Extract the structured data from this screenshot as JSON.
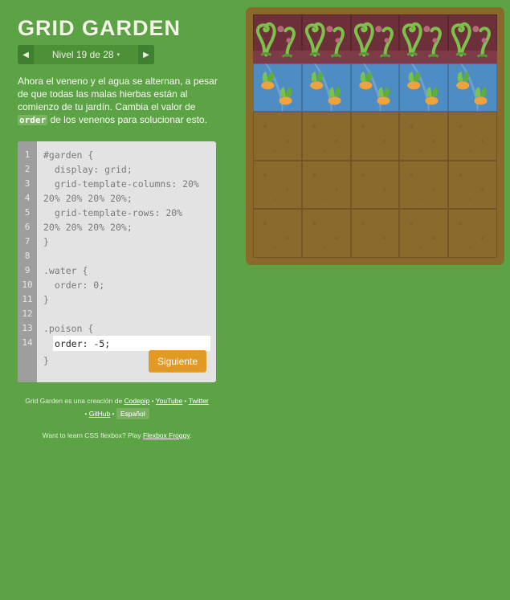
{
  "app": {
    "title": "GRID GARDEN"
  },
  "level_nav": {
    "prev_icon": "chevron-left-icon",
    "next_icon": "chevron-right-icon",
    "label": "Nivel 19 de 28",
    "caret": "▾"
  },
  "instructions": {
    "before_code": "Ahora el veneno y el agua se alternan, a pesar de que todas las malas hierbas están al comienzo de tu jardín. Cambia el valor de ",
    "code_word": "order",
    "after_code": " de los venenos para solucionar esto."
  },
  "editor": {
    "line_numbers": [
      "1",
      "2",
      "3",
      "4",
      "5",
      "6",
      "7",
      "8",
      "9",
      "10",
      "11",
      "12",
      "13",
      "14"
    ],
    "code_lines": [
      "#garden {",
      "  display: grid;",
      "  grid-template-columns: 20%",
      "20% 20% 20% 20%;",
      "  grid-template-rows: 20%",
      "20% 20% 20% 20%;",
      "}",
      "",
      ".water {",
      "  order: 0;",
      "}",
      "",
      ".poison {"
    ],
    "input_value": "order: -5;",
    "closing_brace": "}",
    "next_button_label": "Siguiente"
  },
  "credits": {
    "prefix": "Grid Garden es una creación de ",
    "codepip": "Codepip",
    "sep1": " • ",
    "youtube": "YouTube",
    "sep2": " • ",
    "twitter": "Twitter",
    "sep3": "• ",
    "github": "GitHub",
    "sep4": " • ",
    "language": "Español"
  },
  "promo": {
    "prefix": "Want to learn CSS flexbox? Play ",
    "link": "Flexbox Froggy",
    "suffix": "."
  },
  "garden": {
    "rows": [
      [
        "poison",
        "poison",
        "poison",
        "poison",
        "poison"
      ],
      [
        "water",
        "water",
        "water",
        "water",
        "water"
      ],
      [
        "dirt",
        "dirt",
        "dirt",
        "dirt",
        "dirt"
      ],
      [
        "dirt",
        "dirt",
        "dirt",
        "dirt",
        "dirt"
      ],
      [
        "dirt",
        "dirt",
        "dirt",
        "dirt",
        "dirt"
      ]
    ],
    "colors": {
      "poison": "#6d2f3a",
      "water": "#4d8dc4",
      "dirt": "#8b6a2e",
      "weed": "#7cc24a",
      "carrot": "#f0a23c"
    }
  }
}
